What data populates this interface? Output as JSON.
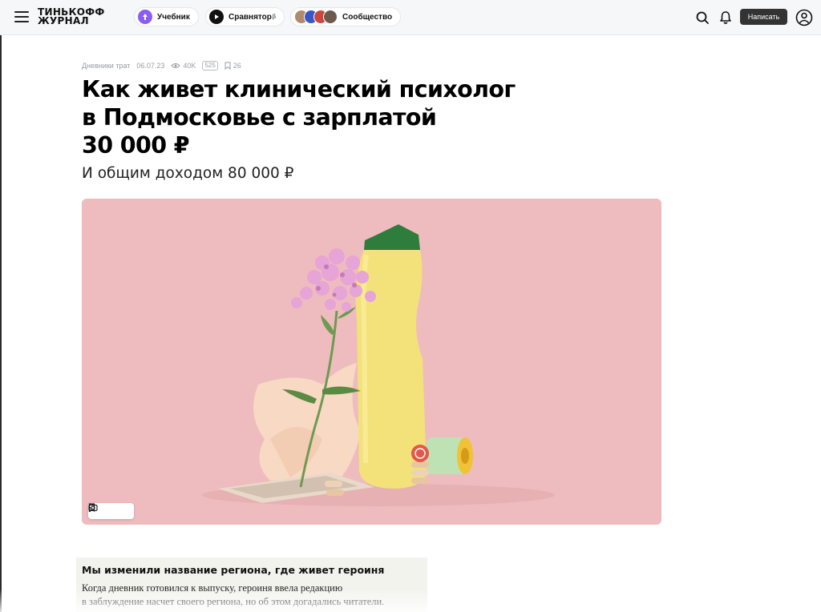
{
  "header": {
    "logo_line1": "ТИНЬКОФФ",
    "logo_line2": "ЖУРНАЛ",
    "nav": {
      "textbook": "Учебник",
      "compare": "Сравнятор",
      "compare_sup": "β",
      "community": "Сообщество"
    },
    "write_label": "Написать",
    "icons": [
      "menu-icon",
      "search-icon",
      "bell-icon",
      "user-icon"
    ],
    "colors": {
      "header_bg": "#f6f7f8",
      "textbook_accent": "#8b5cf6",
      "write_button": "#333333"
    }
  },
  "article": {
    "meta": {
      "category": "Дневники трат",
      "date": "06.07.23",
      "views": "40K",
      "comments": "525",
      "bookmarks": "26"
    },
    "title_lines": [
      "Как живет клинический психолог",
      "в Подмосковье с зарплатой",
      "30 000 ₽"
    ],
    "subtitle": "И общим доходом 80 000 ₽",
    "hero": {
      "background": "#eebcbe",
      "tool_icons": [
        "bookmark-icon",
        "camera-icon",
        "more-icon"
      ]
    },
    "notice": {
      "title": "Мы изменили название региона, где живет героиня",
      "text_lines": [
        "Когда дневник готовился к выпуску, героиня ввела редакцию",
        "в заблуждение насчет своего региона, но об этом догадались читатели."
      ]
    }
  }
}
